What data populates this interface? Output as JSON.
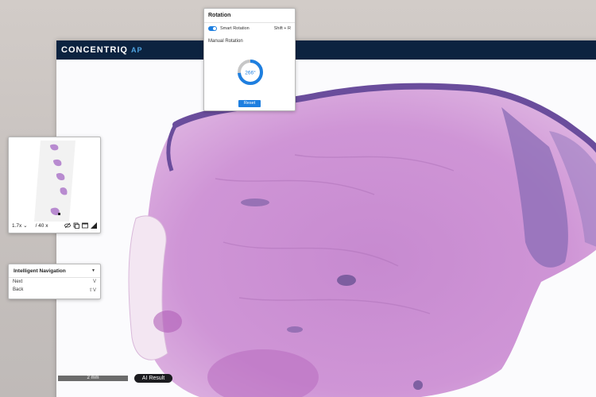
{
  "app": {
    "logo_main": "CONCENTRIQ",
    "logo_sub": "AP"
  },
  "rotation_panel": {
    "title": "Rotation",
    "smart_rotation_label": "Smart Rotation",
    "smart_rotation_enabled": true,
    "smart_rotation_shortcut": "Shift + R",
    "manual_rotation_label": "Manual Rotation",
    "angle_text": "266°",
    "angle_degrees": 266,
    "reset_label": "Reset",
    "accent_color": "#1e7fe0"
  },
  "overview_panel": {
    "zoom_value": "1.7x",
    "max_zoom": "/ 40 x",
    "icons": [
      "hide-annotations-icon",
      "layers-icon",
      "fullscreen-icon",
      "resize-handle-icon"
    ]
  },
  "navigation_panel": {
    "title": "Intelligent Navigation",
    "items": [
      {
        "label": "Next",
        "shortcut": "V"
      },
      {
        "label": "Back",
        "shortcut": "⇧V"
      }
    ]
  },
  "viewer": {
    "scale_label": "2 mm",
    "ai_result_label": "AI Result"
  },
  "colors": {
    "topbar": "#0c2340",
    "tissue_pink": "#c98ad0",
    "tissue_purple": "#7a5aa8"
  }
}
